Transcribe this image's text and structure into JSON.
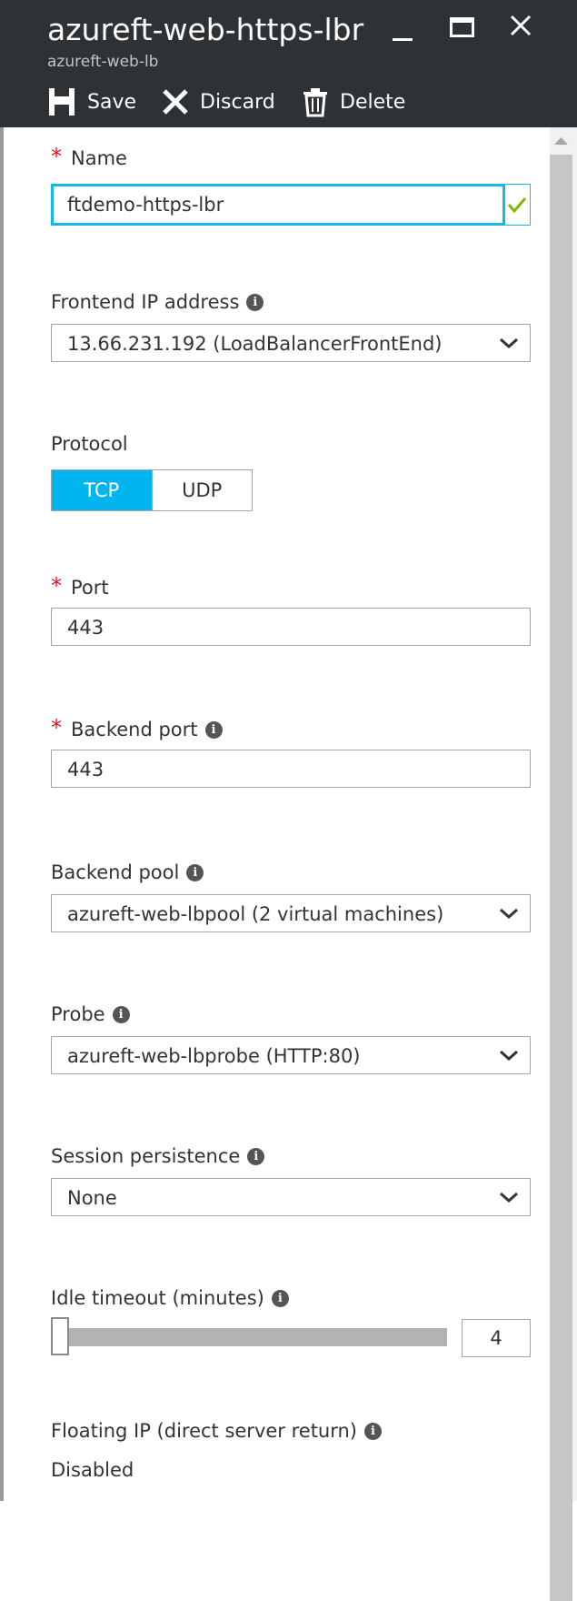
{
  "header": {
    "title": "azureft-web-https-lbr",
    "subtitle": "azureft-web-lb",
    "commands": {
      "save": "Save",
      "discard": "Discard",
      "delete": "Delete"
    }
  },
  "form": {
    "name": {
      "label": "Name",
      "value": "ftdemo-https-lbr",
      "required": true,
      "validated": true
    },
    "frontend_ip": {
      "label": "Frontend IP address",
      "value": "13.66.231.192 (LoadBalancerFrontEnd)"
    },
    "protocol": {
      "label": "Protocol",
      "options": [
        "TCP",
        "UDP"
      ],
      "selected": "TCP"
    },
    "port": {
      "label": "Port",
      "value": "443",
      "required": true
    },
    "backend_port": {
      "label": "Backend port",
      "value": "443",
      "required": true
    },
    "backend_pool": {
      "label": "Backend pool",
      "value": "azureft-web-lbpool (2 virtual machines)"
    },
    "probe": {
      "label": "Probe",
      "value": "azureft-web-lbprobe (HTTP:80)"
    },
    "session_persistence": {
      "label": "Session persistence",
      "value": "None"
    },
    "idle_timeout": {
      "label": "Idle timeout (minutes)",
      "value": "4",
      "slider_fraction": 0
    },
    "floating_ip": {
      "label": "Floating IP (direct server return)",
      "value": "Disabled"
    }
  },
  "colors": {
    "header_bg": "#2f3235",
    "accent": "#00b4f0",
    "required": "#e81123",
    "valid": "#7fba00"
  },
  "icons": {
    "info": "i",
    "required": "*"
  }
}
